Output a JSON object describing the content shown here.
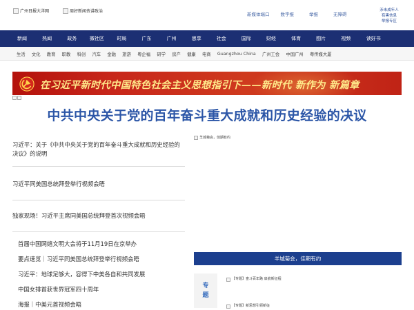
{
  "header": {
    "logo1_text": "广州日报大洋网",
    "logo2_text": "周好新闻去讲政治",
    "links": [
      "新媒体端口",
      "数字报",
      "举报",
      "无障碍"
    ],
    "minor": [
      "涉未成年人",
      "有害信息",
      "举报专区"
    ]
  },
  "nav_main": [
    "新闻",
    "热闻",
    "政务",
    "微社区",
    "时局",
    "广东",
    "广州",
    "思享",
    "社会",
    "国际",
    "财经",
    "体育",
    "图片",
    "视频",
    "读好书"
  ],
  "nav_sub": [
    "生活",
    "文化",
    "教育",
    "职教",
    "科创",
    "汽车",
    "金融",
    "旅游",
    "粤企福",
    "研学",
    "房产",
    "健康",
    "电商",
    "Guangzhou China",
    "广州工会",
    "中国广州",
    "粤传媒大厦"
  ],
  "banner": {
    "slogan": "在习近平新时代中国特色社会主义思想指引下——新时代 新作为 新篇章"
  },
  "headline": "中共中央关于党的百年奋斗重大成就和历史经验的决议",
  "left_articles": [
    "习近平：关于《中共中央关于党的百年奋斗重大成就和历史经验的决议》的说明",
    "习近平同美国总统拜登举行视频会晤",
    "独家现场！习近平主席同美国总统拜登首次视频会晤"
  ],
  "left_list": [
    "首届中国网络文明大会将于11月19日在京举办",
    "要点速览｜习近平同美国总统拜登举行视频会晤",
    "习近平：地球足够大，容得下中美各自和共同发展",
    "中国女排首获世界冠军四十周年",
    "海报｜中美元首视频会晤"
  ],
  "right_panel": {
    "photo_caption": "羊城菊会，佳期有约",
    "bar_text": "羊城菊会，佳期有约",
    "zt_label_top": "专",
    "zt_label_bottom": "题",
    "special_items": [
      "【专题】奋斗百年路 启航新征程",
      "【专题】新思想引领新征"
    ]
  },
  "colors": {
    "nav_bg": "#1c2f73",
    "headline": "#2c56a7",
    "banner_red": "#c7261a",
    "banner_gold": "#ffe98a",
    "bar_bg": "#1c3f8e"
  }
}
